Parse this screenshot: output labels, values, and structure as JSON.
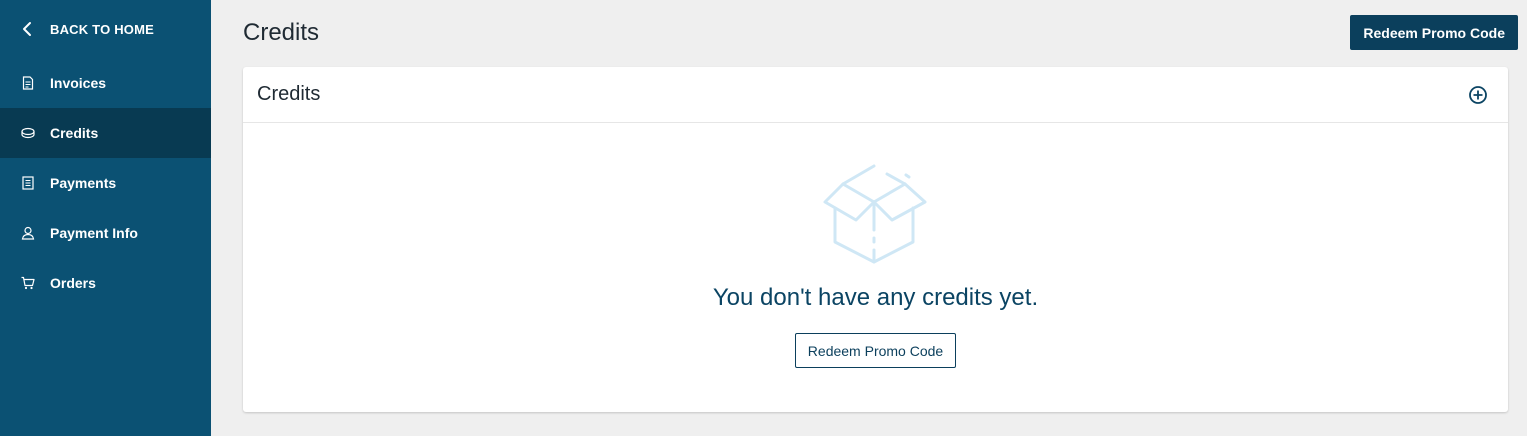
{
  "sidebar": {
    "back_label": "BACK TO HOME",
    "items": [
      {
        "label": "Invoices",
        "icon": "invoice-icon"
      },
      {
        "label": "Credits",
        "icon": "coin-icon",
        "active": true
      },
      {
        "label": "Payments",
        "icon": "receipt-icon"
      },
      {
        "label": "Payment Info",
        "icon": "user-card-icon"
      },
      {
        "label": "Orders",
        "icon": "cart-icon"
      }
    ]
  },
  "header": {
    "title": "Credits",
    "redeem_label": "Redeem Promo Code"
  },
  "card": {
    "title": "Credits",
    "empty_message": "You don't have any credits yet.",
    "redeem_label": "Redeem Promo Code"
  },
  "colors": {
    "sidebar": "#0b5173",
    "sidebar_active": "#083a52",
    "primary": "#0b3f5c",
    "empty_icon": "#cfe7f5"
  }
}
